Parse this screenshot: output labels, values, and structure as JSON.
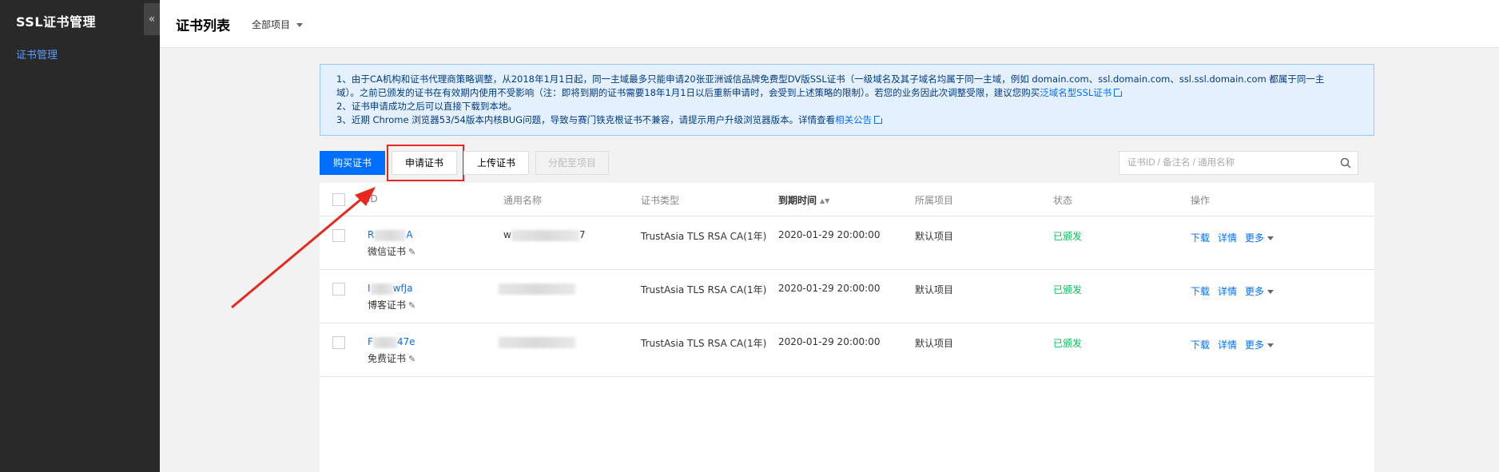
{
  "sidebar": {
    "title": "SSL证书管理",
    "collapse_icon": "«",
    "items": [
      {
        "label": "证书管理"
      }
    ]
  },
  "header": {
    "title": "证书列表",
    "project_select": "全部项目"
  },
  "notice": {
    "line1a": "1、由于CA机构和证书代理商策略调整，从2018年1月1日起，同一主域最多只能申请20张亚洲诚信品牌免费型DV版SSL证书（一级域名及其子域名均属于同一主域，例如 domain.com、ssl.domain.com、ssl.ssl.domain.com 都属于同一主",
    "line1b": "域）。之前已颁发的证书在有效期内使用不受影响（注：即将到期的证书需要18年1月1日以后重新申请时，会受到上述策略的限制）。若您的业务因此次调整受限，建议您购买",
    "line1_link": "泛域名型SSL证书",
    "line2": "2、证书申请成功之后可以直接下载到本地。",
    "line3": "3、近期 Chrome 浏览器53/54版本内核BUG问题，导致与赛门铁克根证书不兼容，请提示用户升级浏览器版本。详情查看",
    "line3_link": "相关公告"
  },
  "toolbar": {
    "buy": "购买证书",
    "apply": "申请证书",
    "upload": "上传证书",
    "assign": "分配至项目",
    "search_placeholder": "证书ID / 备注名 / 通用名称"
  },
  "table": {
    "headers": {
      "id": "ID",
      "common_name": "通用名称",
      "cert_type": "证书类型",
      "expire": "到期时间",
      "project": "所属项目",
      "status": "状态",
      "ops": "操作"
    },
    "rows": [
      {
        "id_prefix": "R",
        "id_suffix": "A",
        "remark": "微信证书",
        "name_prefix": "w",
        "name_suffix": "7",
        "cert_type": "TrustAsia TLS RSA CA(1年)",
        "expire": "2020-01-29 20:00:00",
        "project": "默认项目",
        "status": "已颁发"
      },
      {
        "id_prefix": "I",
        "id_suffix": "wfJa",
        "remark": "博客证书",
        "name_prefix": "",
        "name_suffix": "",
        "cert_type": "TrustAsia TLS RSA CA(1年)",
        "expire": "2020-01-29 20:00:00",
        "project": "默认项目",
        "status": "已颁发"
      },
      {
        "id_prefix": "F",
        "id_suffix": "47e",
        "remark": "免费证书",
        "name_prefix": "",
        "name_suffix": "",
        "cert_type": "TrustAsia TLS RSA CA(1年)",
        "expire": "2020-01-29 20:00:00",
        "project": "默认项目",
        "status": "已颁发"
      }
    ],
    "ops": {
      "download": "下载",
      "detail": "详情",
      "more": "更多"
    }
  },
  "colors": {
    "primary": "#006eff",
    "success": "#0abf5b",
    "highlight": "#e8281f",
    "sidebar_bg": "#292929"
  }
}
